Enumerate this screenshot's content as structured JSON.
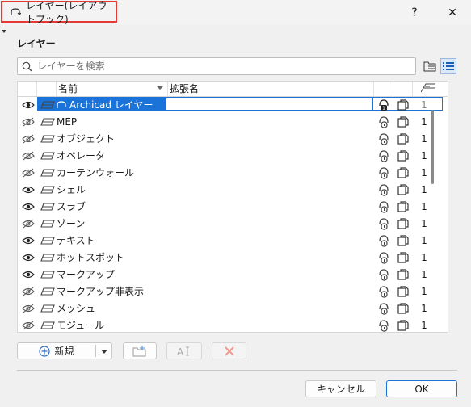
{
  "window": {
    "title": "レイヤー(レイアウトブック)",
    "help": "?",
    "close": "✕"
  },
  "section_title": "レイヤー",
  "search": {
    "placeholder": "レイヤーを検索"
  },
  "columns": {
    "name": "名前",
    "extension": "拡張名"
  },
  "rows": [
    {
      "name": "Archicad レイヤー",
      "visible": true,
      "num": "1",
      "selected": true
    },
    {
      "name": "MEP",
      "visible": false,
      "num": "1"
    },
    {
      "name": "オブジェクト",
      "visible": false,
      "num": "1"
    },
    {
      "name": "オペレータ",
      "visible": false,
      "num": "1"
    },
    {
      "name": "カーテンウォール",
      "visible": false,
      "num": "1"
    },
    {
      "name": "シェル",
      "visible": true,
      "num": "1"
    },
    {
      "name": "スラブ",
      "visible": true,
      "num": "1"
    },
    {
      "name": "ゾーン",
      "visible": false,
      "num": "1"
    },
    {
      "name": "テキスト",
      "visible": true,
      "num": "1"
    },
    {
      "name": "ホットスポット",
      "visible": true,
      "num": "1"
    },
    {
      "name": "マークアップ",
      "visible": true,
      "num": "1"
    },
    {
      "name": "マークアップ非表示",
      "visible": false,
      "num": "1"
    },
    {
      "name": "メッシュ",
      "visible": false,
      "num": "1"
    },
    {
      "name": "モジュール",
      "visible": false,
      "num": "1"
    }
  ],
  "buttons": {
    "new": "新規",
    "cancel": "キャンセル",
    "ok": "OK"
  },
  "colors": {
    "selection": "#1a73d8",
    "highlight_border": "#e53935"
  }
}
